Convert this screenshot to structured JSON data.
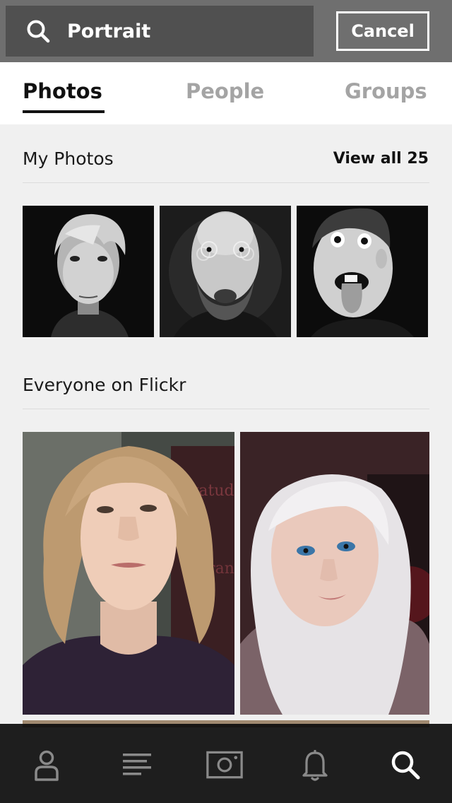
{
  "search": {
    "query": "Portrait",
    "cancel_label": "Cancel",
    "icon": "search-icon"
  },
  "tabs": [
    {
      "label": "Photos",
      "active": true
    },
    {
      "label": "People",
      "active": false
    },
    {
      "label": "Groups",
      "active": false
    }
  ],
  "my_photos": {
    "title": "My Photos",
    "view_all_label": "View all 25",
    "photos": [
      "portrait-young-man-bw",
      "portrait-bald-man-glasses-bw",
      "portrait-boy-tongue-bw"
    ]
  },
  "everyone": {
    "title": "Everyone on Flickr",
    "photos": [
      "portrait-woman-short-blond-hair",
      "portrait-woman-platinum-hair"
    ]
  },
  "bottom_nav": [
    {
      "icon": "profile-icon"
    },
    {
      "icon": "feed-icon"
    },
    {
      "icon": "camera-icon"
    },
    {
      "icon": "notifications-icon"
    },
    {
      "icon": "search-icon",
      "active": true
    }
  ],
  "colors": {
    "header_bg": "#6f6f6f",
    "search_bg": "#505050",
    "active_tab": "#111111",
    "inactive_tab": "#a4a4a4",
    "nav_bg": "#0c0c0c"
  }
}
